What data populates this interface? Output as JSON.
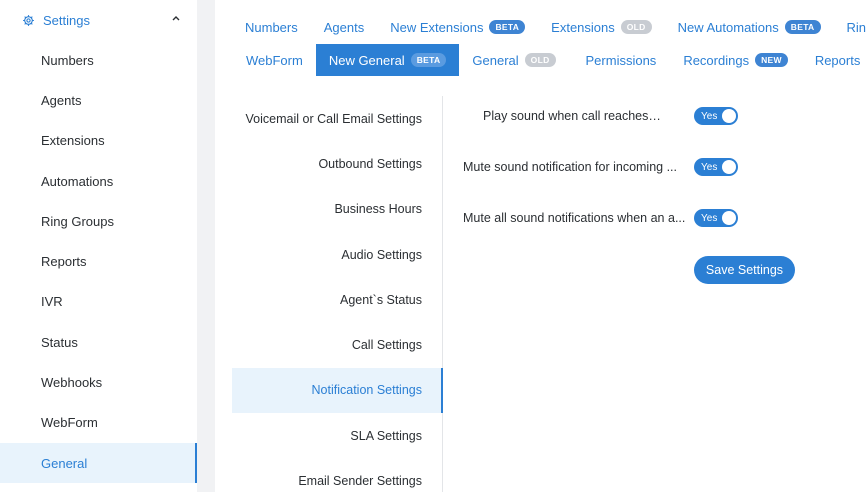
{
  "sidebar": {
    "header": "Settings",
    "items": [
      {
        "label": "Numbers"
      },
      {
        "label": "Agents"
      },
      {
        "label": "Extensions"
      },
      {
        "label": "Automations"
      },
      {
        "label": "Ring Groups"
      },
      {
        "label": "Reports"
      },
      {
        "label": "IVR"
      },
      {
        "label": "Status"
      },
      {
        "label": "Webhooks"
      },
      {
        "label": "WebForm"
      },
      {
        "label": "General",
        "active": true
      }
    ]
  },
  "tabs": {
    "row1": [
      {
        "label": "Numbers"
      },
      {
        "label": "Agents"
      },
      {
        "label": "New Extensions",
        "badge": "BETA"
      },
      {
        "label": "Extensions",
        "badge": "OLD"
      },
      {
        "label": "New Automations",
        "badge": "BETA"
      },
      {
        "label": "Ring Gro"
      }
    ],
    "row2": [
      {
        "label": "WebForm"
      },
      {
        "label": "New General",
        "badge": "BETA",
        "active": true
      },
      {
        "label": "General",
        "badge": "OLD"
      },
      {
        "label": "Permissions"
      },
      {
        "label": "Recordings",
        "badge": "NEW"
      },
      {
        "label": "Reports"
      }
    ]
  },
  "sections": [
    {
      "label": "Voicemail or Call Email Settings"
    },
    {
      "label": "Outbound Settings"
    },
    {
      "label": "Business Hours"
    },
    {
      "label": "Audio Settings"
    },
    {
      "label": "Agent`s Status"
    },
    {
      "label": "Call Settings"
    },
    {
      "label": "Notification Settings",
      "active": true
    },
    {
      "label": "SLA Settings"
    },
    {
      "label": "Email Sender Settings"
    }
  ],
  "settings": [
    {
      "label": "Play sound when call reaches queue?",
      "toggle": "Yes",
      "on": true
    },
    {
      "label": "Mute sound notification for incoming ...",
      "toggle": "Yes",
      "on": true
    },
    {
      "label": "Mute all sound notifications when an a...",
      "toggle": "Yes",
      "on": true
    }
  ],
  "save_label": "Save Settings",
  "colors": {
    "accent": "#2b7fd4",
    "active_bg": "#e8f3fc",
    "badge_old": "#c8ccd2"
  }
}
